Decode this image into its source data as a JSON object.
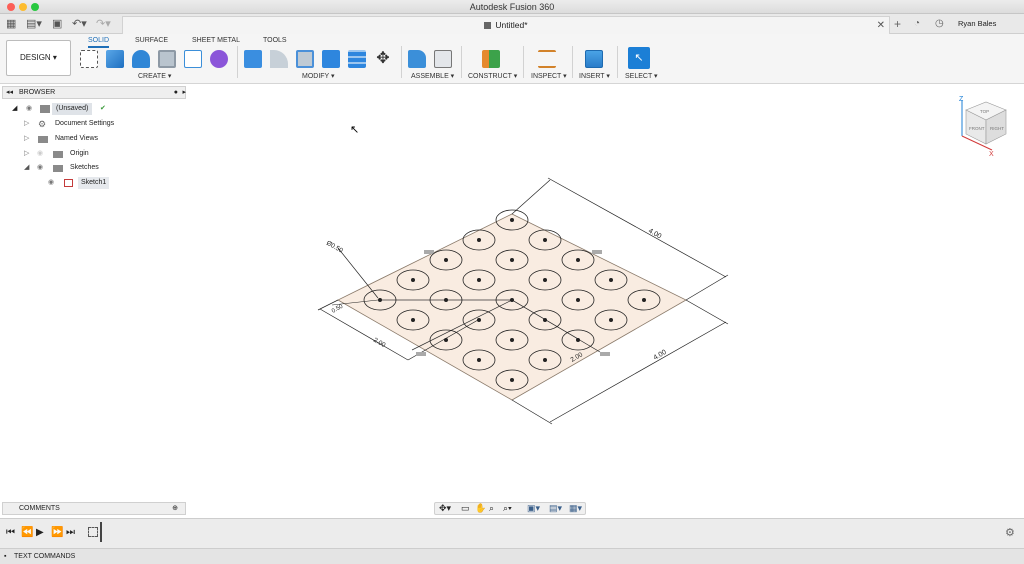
{
  "window": {
    "title": "Autodesk Fusion 360"
  },
  "document_tab": {
    "title": "Untitled*"
  },
  "user": {
    "name": "Ryan Bales"
  },
  "workspace": {
    "label": "DESIGN ▾"
  },
  "ribbon": {
    "tabs": [
      {
        "label": "SOLID",
        "active": true
      },
      {
        "label": "SURFACE",
        "active": false
      },
      {
        "label": "SHEET METAL",
        "active": false
      },
      {
        "label": "TOOLS",
        "active": false
      }
    ],
    "groups": [
      {
        "label": "CREATE ▾"
      },
      {
        "label": "MODIFY ▾"
      },
      {
        "label": "ASSEMBLE ▾"
      },
      {
        "label": "CONSTRUCT ▾"
      },
      {
        "label": "INSPECT ▾"
      },
      {
        "label": "INSERT ▾"
      },
      {
        "label": "SELECT ▾"
      }
    ]
  },
  "browser": {
    "title": "BROWSER",
    "items": [
      {
        "label": "(Unsaved)",
        "icon": "document-icon"
      },
      {
        "label": "Document Settings",
        "icon": "gear-icon"
      },
      {
        "label": "Named Views",
        "icon": "folder-icon"
      },
      {
        "label": "Origin",
        "icon": "folder-icon"
      },
      {
        "label": "Sketches",
        "icon": "folder-icon"
      },
      {
        "label": "Sketch1",
        "icon": "sketch-icon"
      }
    ]
  },
  "comments": {
    "title": "COMMENTS"
  },
  "text_commands": {
    "label": "TEXT COMMANDS"
  },
  "viewcube": {
    "axis_x": "X",
    "axis_z": "Z",
    "face_top": "TOP",
    "face_front": "FRONT",
    "face_right": "RIGHT"
  },
  "sketch": {
    "dimensions": [
      "4.00",
      "4.00",
      "2.00",
      "2.00",
      "0.50",
      "Ø0.50"
    ]
  },
  "colors": {
    "accent": "#1f6fb8",
    "sketch_fill": "#f9ece1",
    "select_blue": "#1c7fd6"
  }
}
